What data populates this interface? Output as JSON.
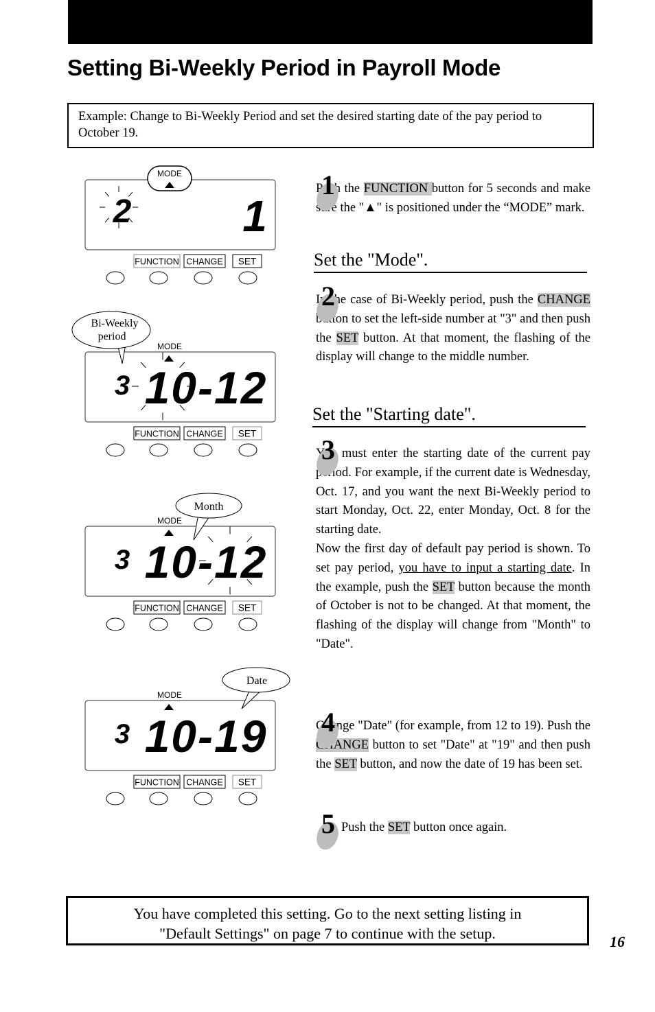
{
  "header": {
    "title": "Setting Bi-Weekly Period in Payroll Mode"
  },
  "example": {
    "text": "Example: Change to Bi-Weekly Period and set the desired starting date of the pay period to October 19."
  },
  "panel_labels": {
    "mode": "MODE",
    "function": "FUNCTION",
    "change": "CHANGE",
    "set": "SET"
  },
  "panels": [
    {
      "left_digit": "2",
      "right": "1",
      "callout": null
    },
    {
      "left_digit": "3",
      "right": "10-12",
      "callout": "Bi-Weekly period",
      "callout_lines": [
        "Bi-Weekly",
        "period"
      ]
    },
    {
      "left_digit": "3",
      "right": "10-12",
      "callout": "Month"
    },
    {
      "left_digit": "3",
      "right": "10-19",
      "callout": "Date"
    }
  ],
  "sections": {
    "mode": "Set the \"Mode\".",
    "starting_date": "Set the \"Starting date\"."
  },
  "steps": [
    {
      "number": "1",
      "parts": [
        "Push the ",
        "FUNCTION ",
        " button for 5 seconds and make sure the \"",
        "▲",
        "\" is positioned under the “MODE” mark."
      ]
    },
    {
      "number": "2",
      "parts": [
        "In the case of Bi-Weekly period, push the ",
        "CHANGE",
        " button to set the left-side number at \"3\" and then push the ",
        "SET",
        " button. At that moment, the flashing of the display will change to the middle number."
      ]
    },
    {
      "number": "3",
      "parts": [
        "You must enter the starting date of the current pay period. For example, if the current date is Wednesday, Oct. 17, and you want the next Bi-Weekly period to start Monday, Oct. 22, enter Monday, Oct. 8 for the starting date.",
        "Now the first day of default pay period is shown. To set pay period, ",
        "you have to input a starting date",
        ". In the example, push the ",
        "SET",
        " button because the month of October is not to be changed. At that moment, the flashing of the display will change from \"Month\" to \"Date\"."
      ]
    },
    {
      "number": "4",
      "parts": [
        "Change \"Date\" (for example, from 12 to 19). Push the ",
        "CHANGE",
        " button to set \"Date\" at \"19\" and then push the ",
        "SET",
        " button, and now the date of 19 has been set."
      ]
    },
    {
      "number": "5",
      "parts": [
        "Push the ",
        "SET",
        " button once again."
      ]
    }
  ],
  "footer": {
    "line1": "You have completed this setting.  Go to the next setting listing in",
    "line2": "\"Default Settings\" on page 7 to continue with the setup."
  },
  "page_number": "16"
}
